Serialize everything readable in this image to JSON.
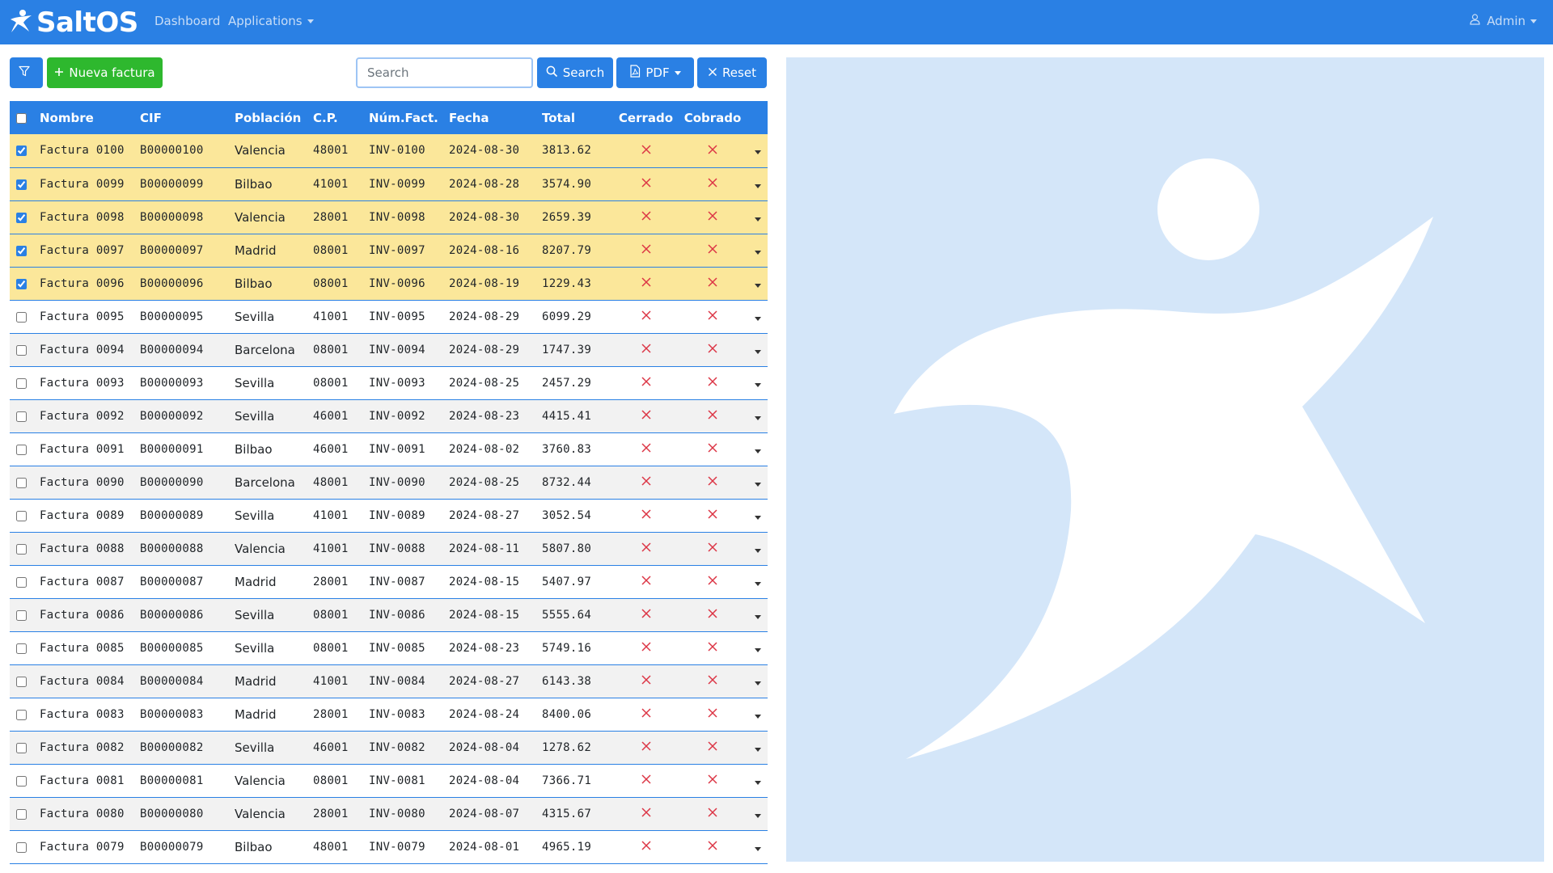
{
  "app": {
    "brand": "SaltOS"
  },
  "nav": {
    "dashboard": "Dashboard",
    "applications": "Applications",
    "user": "Admin"
  },
  "toolbar": {
    "new_label": "Nueva factura",
    "search_placeholder": "Search",
    "search_label": "Search",
    "pdf_label": "PDF",
    "reset_label": "Reset"
  },
  "table": {
    "columns": [
      "Nombre",
      "CIF",
      "Población",
      "C.P.",
      "Núm.Fact.",
      "Fecha",
      "Total",
      "Cerrado",
      "Cobrado"
    ],
    "rows": [
      {
        "nombre": "Factura 0100",
        "cif": "B00000100",
        "poblacion": "Valencia",
        "cp": "48001",
        "num": "INV-0100",
        "fecha": "2024-08-30",
        "total": "3813.62",
        "cerrado": false,
        "cobrado": false,
        "selected": true
      },
      {
        "nombre": "Factura 0099",
        "cif": "B00000099",
        "poblacion": "Bilbao",
        "cp": "41001",
        "num": "INV-0099",
        "fecha": "2024-08-28",
        "total": "3574.90",
        "cerrado": false,
        "cobrado": false,
        "selected": true
      },
      {
        "nombre": "Factura 0098",
        "cif": "B00000098",
        "poblacion": "Valencia",
        "cp": "28001",
        "num": "INV-0098",
        "fecha": "2024-08-30",
        "total": "2659.39",
        "cerrado": false,
        "cobrado": false,
        "selected": true
      },
      {
        "nombre": "Factura 0097",
        "cif": "B00000097",
        "poblacion": "Madrid",
        "cp": "08001",
        "num": "INV-0097",
        "fecha": "2024-08-16",
        "total": "8207.79",
        "cerrado": false,
        "cobrado": false,
        "selected": true
      },
      {
        "nombre": "Factura 0096",
        "cif": "B00000096",
        "poblacion": "Bilbao",
        "cp": "08001",
        "num": "INV-0096",
        "fecha": "2024-08-19",
        "total": "1229.43",
        "cerrado": false,
        "cobrado": false,
        "selected": true
      },
      {
        "nombre": "Factura 0095",
        "cif": "B00000095",
        "poblacion": "Sevilla",
        "cp": "41001",
        "num": "INV-0095",
        "fecha": "2024-08-29",
        "total": "6099.29",
        "cerrado": false,
        "cobrado": false,
        "selected": false
      },
      {
        "nombre": "Factura 0094",
        "cif": "B00000094",
        "poblacion": "Barcelona",
        "cp": "08001",
        "num": "INV-0094",
        "fecha": "2024-08-29",
        "total": "1747.39",
        "cerrado": false,
        "cobrado": false,
        "selected": false
      },
      {
        "nombre": "Factura 0093",
        "cif": "B00000093",
        "poblacion": "Sevilla",
        "cp": "08001",
        "num": "INV-0093",
        "fecha": "2024-08-25",
        "total": "2457.29",
        "cerrado": false,
        "cobrado": false,
        "selected": false
      },
      {
        "nombre": "Factura 0092",
        "cif": "B00000092",
        "poblacion": "Sevilla",
        "cp": "46001",
        "num": "INV-0092",
        "fecha": "2024-08-23",
        "total": "4415.41",
        "cerrado": false,
        "cobrado": false,
        "selected": false
      },
      {
        "nombre": "Factura 0091",
        "cif": "B00000091",
        "poblacion": "Bilbao",
        "cp": "46001",
        "num": "INV-0091",
        "fecha": "2024-08-02",
        "total": "3760.83",
        "cerrado": false,
        "cobrado": false,
        "selected": false
      },
      {
        "nombre": "Factura 0090",
        "cif": "B00000090",
        "poblacion": "Barcelona",
        "cp": "48001",
        "num": "INV-0090",
        "fecha": "2024-08-25",
        "total": "8732.44",
        "cerrado": false,
        "cobrado": false,
        "selected": false
      },
      {
        "nombre": "Factura 0089",
        "cif": "B00000089",
        "poblacion": "Sevilla",
        "cp": "41001",
        "num": "INV-0089",
        "fecha": "2024-08-27",
        "total": "3052.54",
        "cerrado": false,
        "cobrado": false,
        "selected": false
      },
      {
        "nombre": "Factura 0088",
        "cif": "B00000088",
        "poblacion": "Valencia",
        "cp": "41001",
        "num": "INV-0088",
        "fecha": "2024-08-11",
        "total": "5807.80",
        "cerrado": false,
        "cobrado": false,
        "selected": false
      },
      {
        "nombre": "Factura 0087",
        "cif": "B00000087",
        "poblacion": "Madrid",
        "cp": "28001",
        "num": "INV-0087",
        "fecha": "2024-08-15",
        "total": "5407.97",
        "cerrado": false,
        "cobrado": false,
        "selected": false
      },
      {
        "nombre": "Factura 0086",
        "cif": "B00000086",
        "poblacion": "Sevilla",
        "cp": "08001",
        "num": "INV-0086",
        "fecha": "2024-08-15",
        "total": "5555.64",
        "cerrado": false,
        "cobrado": false,
        "selected": false
      },
      {
        "nombre": "Factura 0085",
        "cif": "B00000085",
        "poblacion": "Sevilla",
        "cp": "08001",
        "num": "INV-0085",
        "fecha": "2024-08-23",
        "total": "5749.16",
        "cerrado": false,
        "cobrado": false,
        "selected": false
      },
      {
        "nombre": "Factura 0084",
        "cif": "B00000084",
        "poblacion": "Madrid",
        "cp": "41001",
        "num": "INV-0084",
        "fecha": "2024-08-27",
        "total": "6143.38",
        "cerrado": false,
        "cobrado": false,
        "selected": false
      },
      {
        "nombre": "Factura 0083",
        "cif": "B00000083",
        "poblacion": "Madrid",
        "cp": "28001",
        "num": "INV-0083",
        "fecha": "2024-08-24",
        "total": "8400.06",
        "cerrado": false,
        "cobrado": false,
        "selected": false
      },
      {
        "nombre": "Factura 0082",
        "cif": "B00000082",
        "poblacion": "Sevilla",
        "cp": "46001",
        "num": "INV-0082",
        "fecha": "2024-08-04",
        "total": "1278.62",
        "cerrado": false,
        "cobrado": false,
        "selected": false
      },
      {
        "nombre": "Factura 0081",
        "cif": "B00000081",
        "poblacion": "Valencia",
        "cp": "08001",
        "num": "INV-0081",
        "fecha": "2024-08-04",
        "total": "7366.71",
        "cerrado": false,
        "cobrado": false,
        "selected": false
      },
      {
        "nombre": "Factura 0080",
        "cif": "B00000080",
        "poblacion": "Valencia",
        "cp": "28001",
        "num": "INV-0080",
        "fecha": "2024-08-07",
        "total": "4315.67",
        "cerrado": false,
        "cobrado": false,
        "selected": false
      },
      {
        "nombre": "Factura 0079",
        "cif": "B00000079",
        "poblacion": "Bilbao",
        "cp": "48001",
        "num": "INV-0079",
        "fecha": "2024-08-01",
        "total": "4965.19",
        "cerrado": false,
        "cobrado": false,
        "selected": false
      }
    ]
  },
  "colors": {
    "primary": "#2a80e4",
    "success": "#2eb82e",
    "selected_row": "#fbe79a",
    "danger": "#dc3545",
    "hero_bg": "#d4e6f9"
  },
  "icons": {
    "brand": "saltos-logo-icon",
    "user": "person-icon",
    "filter": "funnel-icon",
    "new": "plus-icon",
    "search": "search-icon",
    "pdf": "file-pdf-icon",
    "reset": "x-icon",
    "boolean_false": "x-icon",
    "row_menu": "caret-down-icon",
    "hero": "saltos-figure-illustration"
  }
}
